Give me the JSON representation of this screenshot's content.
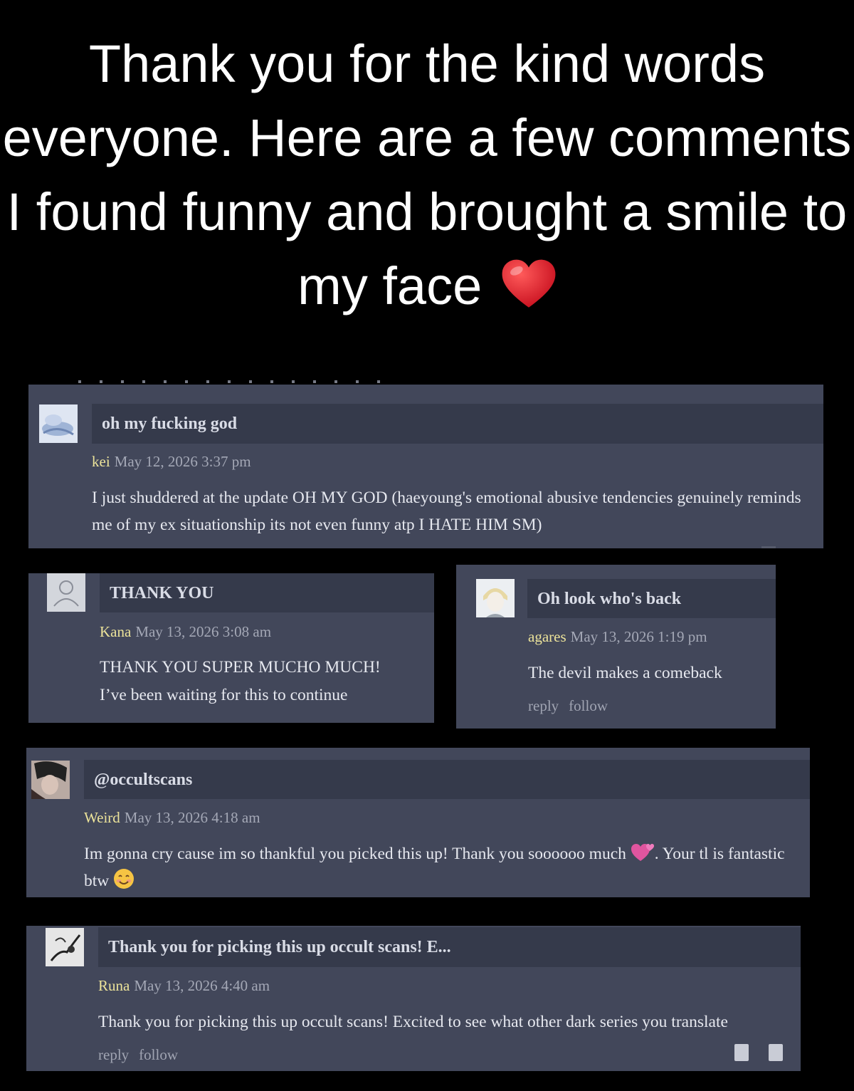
{
  "headline": {
    "text": "Thank you for the kind words everyone. Here are a few comments I found funny and brought a smile to my face",
    "emoji": "red-heart"
  },
  "colors": {
    "background": "#000000",
    "card": "#42475a",
    "titlebar": "#353a4b",
    "username": "#ece39a",
    "date": "#a4a8b6",
    "text": "#e6e8ef"
  },
  "comments": [
    {
      "title": "oh my fucking god",
      "user": "kei",
      "date": "May 12, 2026 3:37 pm",
      "body": "I just shuddered at the update OH MY GOD (haeyoung's emotional abusive tendencies genuinely reminds me of my ex situationship its not even funny atp I HATE HIM SM)",
      "avatar": "blue-anime-avatar"
    },
    {
      "title": "THANK YOU",
      "user": "Kana",
      "date": "May 13, 2026 3:08 am",
      "body_line1": "THANK YOU SUPER MUCHO MUCH!",
      "body_line2": "I’ve been waiting for this to continue",
      "avatar": "default-user-avatar"
    },
    {
      "title": "Oh look who's back",
      "user": "agares",
      "date": "May 13, 2026 1:19 pm",
      "body": "The devil makes a comeback",
      "reply": "reply",
      "follow": "follow",
      "avatar": "blonde-anime-avatar"
    },
    {
      "title": "@occultscans",
      "user": "Weird",
      "date": "May 13, 2026 4:18 am",
      "body_part1": "Im gonna cry cause im so thankful you picked this up! Thank you soooooo much",
      "body_part2": ". Your tl is fantastic btw",
      "avatar": "dark-hair-anime-avatar"
    },
    {
      "title": "Thank you for picking this up occult scans! E...",
      "user": "Runa",
      "date": "May 13, 2026 4:40 am",
      "body": "Thank you for picking this up occult scans! Excited to see what other dark series you translate",
      "reply": "reply",
      "follow": "follow",
      "avatar": "ink-sketch-avatar"
    }
  ]
}
